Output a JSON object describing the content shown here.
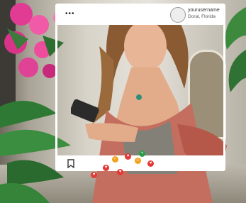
{
  "post": {
    "username": "yourusername",
    "location": "Doral, Florida"
  },
  "icons": {
    "menu": "more-dots-icon",
    "bookmark": "bookmark-icon",
    "reactions": [
      "heart-icon",
      "thumbs-up-icon",
      "like-icon",
      "heart-icon",
      "smile-icon",
      "heart-icon",
      "thumbs-up-icon",
      "heart-icon"
    ]
  },
  "colors": {
    "frame": "#ffffff",
    "reaction_red": "#e53935",
    "reaction_orange": "#f4a11a",
    "reaction_green": "#2e9d4a"
  }
}
